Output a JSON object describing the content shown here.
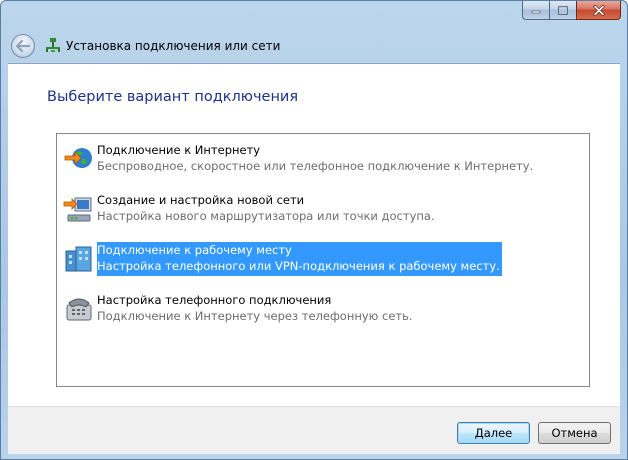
{
  "window": {
    "title": "Установка подключения или сети"
  },
  "heading": "Выберите вариант подключения",
  "options": [
    {
      "title": "Подключение к Интернету",
      "description": "Беспроводное, скоростное или телефонное подключение к Интернету.",
      "icon": "globe-network-icon",
      "selected": false
    },
    {
      "title": "Создание и настройка новой сети",
      "description": "Настройка нового маршрутизатора или точки доступа.",
      "icon": "router-setup-icon",
      "selected": false
    },
    {
      "title": "Подключение к рабочему месту",
      "description": "Настройка телефонного или VPN-подключения к рабочему месту.",
      "icon": "workplace-buildings-icon",
      "selected": true
    },
    {
      "title": "Настройка телефонного подключения",
      "description": "Подключение к Интернету через телефонную сеть.",
      "icon": "telephone-modem-icon",
      "selected": false
    }
  ],
  "buttons": {
    "next": "Далее",
    "cancel": "Отмена"
  },
  "colors": {
    "selection": "#3399ff",
    "heading": "#1e3287"
  }
}
